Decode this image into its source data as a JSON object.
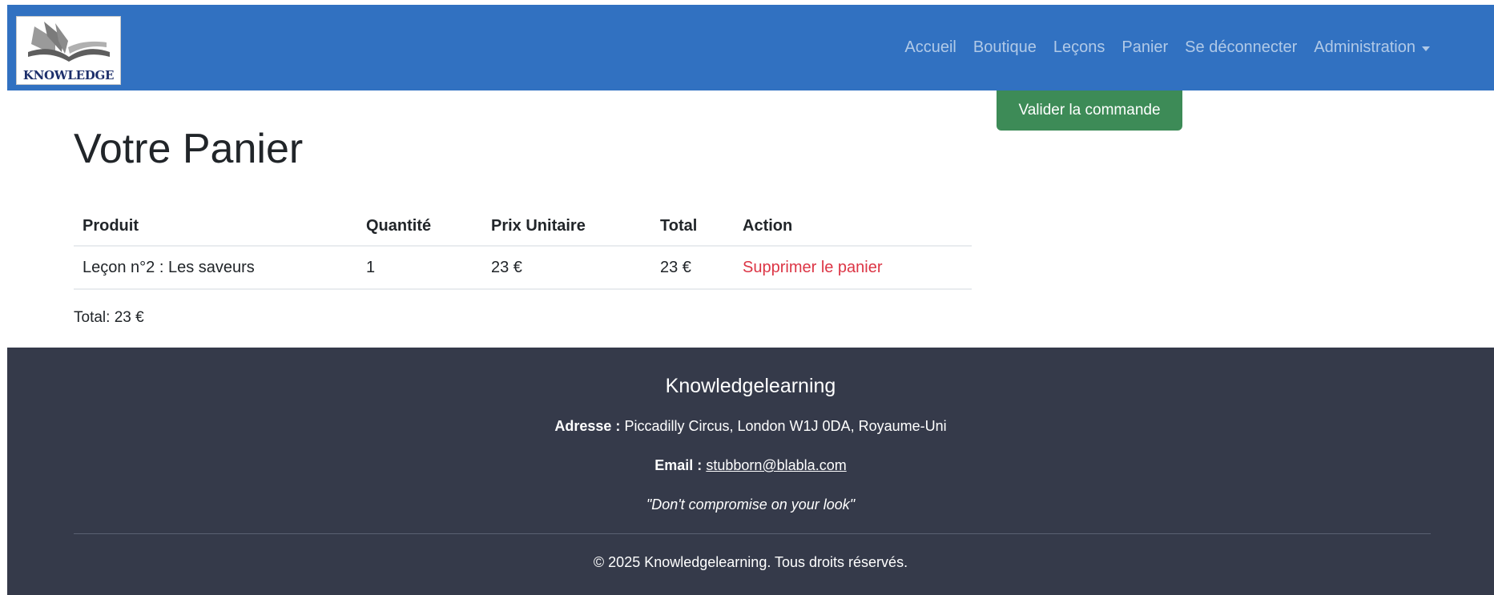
{
  "header": {
    "logo_text": "KNOWLEDGE",
    "nav": [
      {
        "label": "Accueil"
      },
      {
        "label": "Boutique"
      },
      {
        "label": "Leçons"
      },
      {
        "label": "Panier"
      },
      {
        "label": "Se déconnecter"
      },
      {
        "label": "Administration",
        "dropdown": true
      }
    ],
    "brand_color": "#3171c1"
  },
  "actions": {
    "validate_label": "Valider la commande",
    "validate_color": "#3d8b57"
  },
  "main": {
    "title": "Votre Panier",
    "table": {
      "columns": [
        "Produit",
        "Quantité",
        "Prix Unitaire",
        "Total",
        "Action"
      ],
      "rows": [
        {
          "product": "Leçon n°2 : Les saveurs",
          "quantity": "1",
          "unit_price": "23 €",
          "total": "23 €",
          "action": "Supprimer le panier"
        }
      ]
    },
    "total_text": "Total: 23 €"
  },
  "footer": {
    "brand": "Knowledgelearning",
    "address_label": "Adresse :",
    "address": "Piccadilly Circus, London W1J 0DA, Royaume-Uni",
    "email_label": "Email :",
    "email": "stubborn@blabla.com",
    "quote": "\"Don't compromise on your look\"",
    "copyright": "© 2025 Knowledgelearning. Tous droits réservés.",
    "background_color": "#353a4a"
  }
}
